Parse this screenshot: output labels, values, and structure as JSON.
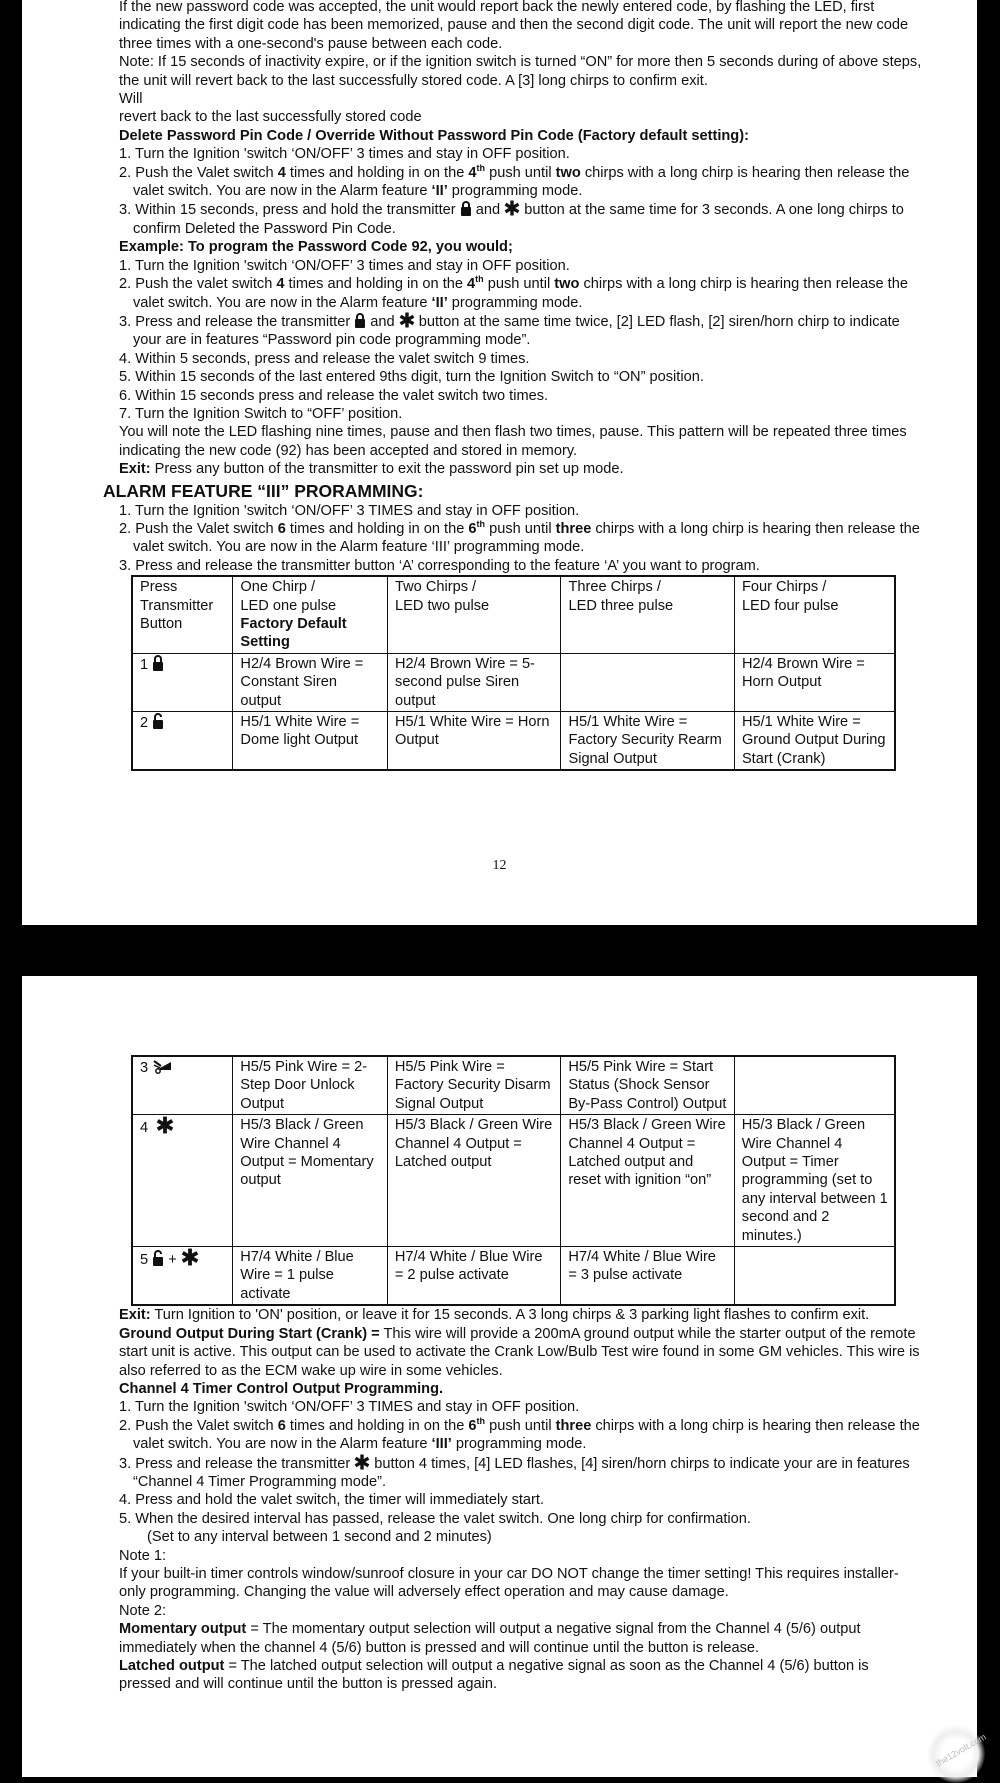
{
  "page1": {
    "intro": [
      "If the new password code was accepted, the unit would report back the newly entered code, by flashing the LED, first indicating the first digit code has been memorized, pause and then the second digit code. The unit will report the new code three times with a one-second's pause between each code.",
      "Note: If 15 seconds of inactivity expire, or if the ignition switch is turned “ON” for more then 5 seconds during of above steps, the unit will revert back to the last successfully stored code. A [3] long chirps to confirm exit.",
      "Will",
      "revert back to the last successfully stored code"
    ],
    "delete_section": {
      "title": "Delete Password Pin Code / Override Without Password Pin Code (Factory default setting):",
      "step1": "1. Turn the Ignition 'switch ‘ON/OFF’ 3 times and stay in OFF position.",
      "step2_a": "2. Push the Valet switch ",
      "step2_b": "4",
      "step2_c": " times and holding in on the ",
      "step2_d": "4",
      "step2_sup": "th",
      "step2_e": " push until ",
      "step2_f": "two",
      "step2_g": " chirps with a long chirp is hearing then release the valet switch. You are now in the Alarm feature ",
      "step2_h": "‘II’",
      "step2_i": " programming mode.",
      "step3_a": "3. Within 15 seconds, press and hold the transmitter ",
      "step3_b": " and ",
      "step3_c": " button at the same time for 3 seconds. A one long chirps to confirm Deleted the Password Pin Code."
    },
    "example_section": {
      "title": "Example: To program the Password Code 92, you would;",
      "step1": "1. Turn the Ignition 'switch ‘ON/OFF’ 3 times and stay in OFF position.",
      "step2_a": "2. Push the valet switch ",
      "step2_b": "4",
      "step2_c": " times and holding in on the ",
      "step2_d": "4",
      "step2_sup": "th",
      "step2_e": " push until ",
      "step2_f": "two",
      "step2_g": " chirps with a long chirp is hearing then release the valet switch. You are now in the Alarm feature ",
      "step2_h": "‘II’",
      "step2_i": " programming mode.",
      "step3_a": "3. Press and release the transmitter ",
      "step3_b": " and ",
      "step3_c": " button at the same time twice, [2] LED flash, [2] siren/horn chirp to indicate your are in features “Password pin code programming mode”.",
      "step4": "4. Within 5 seconds, press and release the valet switch 9 times.",
      "step5": "5. Within 15 seconds of the last entered 9ths digit, turn the Ignition Switch to “ON” position.",
      "step6": "6. Within 15 seconds press and release the valet switch two times.",
      "step7": "7. Turn the Ignition Switch to “OFF’ position.",
      "result": "You will note the LED flashing nine times, pause and then flash two times, pause. This pattern will be repeated three times indicating the new code (92) has been accepted and stored in memory.",
      "exit_label": "Exit:",
      "exit_text": " Press any button of the transmitter to exit the password pin set up mode."
    },
    "alarm3": {
      "title": "ALARM FEATURE “III” PRORAMMING:",
      "step1": "1. Turn the Ignition 'switch ‘ON/OFF’ 3 TIMES and stay in OFF position.",
      "step2_a": "2. Push the Valet switch ",
      "step2_b": "6",
      "step2_c": " times and holding in on the ",
      "step2_d": "6",
      "step2_sup": "th",
      "step2_e": " push until ",
      "step2_f": "three",
      "step2_g": " chirps with a long chirp is hearing then release the valet switch. You are now in the Alarm feature ‘III’ programming mode.",
      "step3": "3. Press and release the transmitter button ‘A’ corresponding to the feature ‘A’ you want to program."
    },
    "table": {
      "header": {
        "col1": "Press Transmitter Button",
        "col2_a": "One Chirp /",
        "col2_b": "LED one pulse",
        "col2_c": "Factory Default Setting",
        "col3_a": "Two Chirps /",
        "col3_b": "LED two pulse",
        "col4_a": "Three Chirps /",
        "col4_b": "LED three pulse",
        "col5_a": "Four Chirps /",
        "col5_b": "LED four pulse"
      },
      "rows": [
        {
          "num": "1",
          "icon": "lock-closed-icon",
          "c1": "H2/4 Brown Wire = Constant Siren output",
          "c2": "H2/4 Brown Wire = 5-second pulse Siren output",
          "c3": "",
          "c4": "H2/4 Brown Wire = Horn Output"
        },
        {
          "num": "2",
          "icon": "lock-open-icon",
          "c1": "H5/1 White Wire = Dome light Output",
          "c2": "H5/1 White Wire = Horn Output",
          "c3": "H5/1 White Wire = Factory Security Rearm Signal Output",
          "c4": "H5/1 White Wire = Ground Output During Start (Crank)"
        }
      ]
    },
    "page_number": "12"
  },
  "page2": {
    "table_rows": [
      {
        "num": "3",
        "icon": "trunk-icon",
        "c1": "H5/5 Pink Wire = 2-Step Door Unlock Output",
        "c2": "H5/5 Pink Wire = Factory Security Disarm Signal Output",
        "c3": "H5/5 Pink Wire = Start Status (Shock Sensor By-Pass Control) Output",
        "c4": ""
      },
      {
        "num": "4",
        "icon": "asterisk-icon",
        "c1": "H5/3 Black / Green Wire Channel 4 Output = Momentary output",
        "c2": "H5/3 Black / Green Wire Channel 4 Output = Latched output",
        "c3": "H5/3 Black / Green Wire Channel 4 Output = Latched output and reset with ignition “on”",
        "c4": "H5/3 Black / Green Wire Channel 4 Output = Timer programming (set to any interval between 1 second and 2 minutes.)"
      },
      {
        "num": "5",
        "icon": "lock-open-plus-asterisk-icon",
        "plus": "+",
        "c1": "H7/4 White / Blue Wire = 1 pulse activate",
        "c2": "H7/4 White / Blue Wire = 2 pulse activate",
        "c3": "H7/4 White / Blue Wire = 3 pulse activate",
        "c4": ""
      }
    ],
    "exit_label": "Exit:",
    "exit_text": " Turn Ignition to 'ON' position, or leave it for 15 seconds. A 3 long chirps & 3 parking light flashes to confirm exit.",
    "ground_label": "Ground Output During Start (Crank) =",
    "ground_text": " This wire will provide a 200mA ground output while the starter output of the remote start unit is active. This output can be used to activate the Crank Low/Bulb Test wire found in some GM vehicles. This wire is also referred to as the ECM wake up wire in some vehicles.",
    "ch4_title": "Channel 4 Timer Control Output Programming.",
    "ch4_step1": "1. Turn the Ignition 'switch ‘ON/OFF’ 3 TIMES and stay in OFF position.",
    "ch4_step2_a": "2. Push the Valet switch ",
    "ch4_step2_b": "6",
    "ch4_step2_c": " times and holding in on the ",
    "ch4_step2_d": "6",
    "ch4_step2_sup": "th",
    "ch4_step2_e": " push until ",
    "ch4_step2_f": "three",
    "ch4_step2_g": " chirps with a long chirp is hearing then release the valet switch. You are now in the Alarm feature ",
    "ch4_step2_h": "‘III’",
    "ch4_step2_i": " programming mode.",
    "ch4_step3_a": "3. Press and release the transmitter ",
    "ch4_step3_b": " button 4 times, [4] LED flashes, [4] siren/horn chirps to indicate your are in features “Channel 4 Timer Programming mode”.",
    "ch4_step4": "4. Press and hold the valet switch, the timer will immediately start.",
    "ch4_step5": "5. When the desired interval has passed, release the valet switch. One long chirp for confirmation.",
    "ch4_step5_note": "(Set to any interval between 1 second and 2 minutes)",
    "note1_label": "Note 1:",
    "note1_text": "If your built-in timer controls window/sunroof closure in your car DO NOT change the timer setting! This requires installer-only programming. Changing the value will adversely effect operation and may cause damage.",
    "note2_label": "Note 2:",
    "momentary_label": "Momentary output",
    "momentary_text": " = The momentary output selection will output a negative signal from the Channel 4 (5/6) output immediately when the channel 4 (5/6) button is pressed and will continue until the button is release.",
    "latched_label": "Latched output",
    "latched_text": " = The latched output selection will output a negative signal as soon as the Channel 4 (5/6) button is pressed and will continue until the button is pressed again.",
    "watermark": "the12volt.com"
  }
}
